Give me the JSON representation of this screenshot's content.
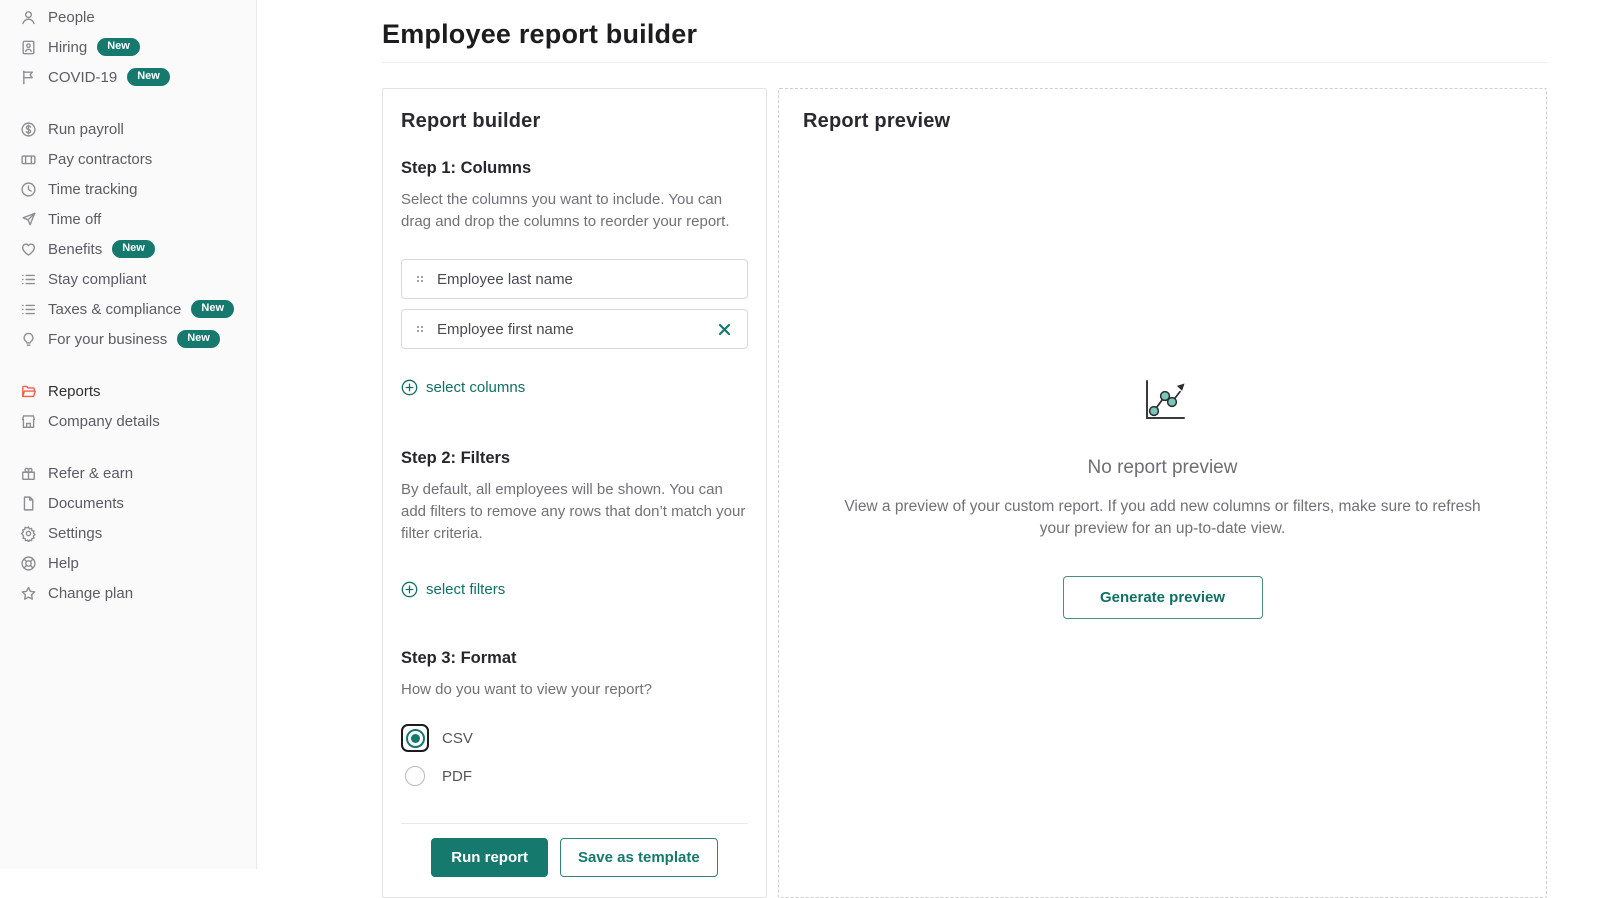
{
  "colors": {
    "teal": "#15796d",
    "coral": "#f45d48",
    "badge_bg": "#15796d"
  },
  "page": {
    "title": "Employee report builder"
  },
  "sidebar": {
    "groups": [
      {
        "items": [
          {
            "label": "People",
            "icon": "people-icon",
            "badge": null
          },
          {
            "label": "Hiring",
            "icon": "id-badge-icon",
            "badge": "New"
          },
          {
            "label": "COVID-19",
            "icon": "flag-icon",
            "badge": "New"
          }
        ]
      },
      {
        "items": [
          {
            "label": "Run payroll",
            "icon": "dollar-circle-icon",
            "badge": null
          },
          {
            "label": "Pay contractors",
            "icon": "wallet-icon",
            "badge": null
          },
          {
            "label": "Time tracking",
            "icon": "clock-icon",
            "badge": null
          },
          {
            "label": "Time off",
            "icon": "airplane-icon",
            "badge": null
          },
          {
            "label": "Benefits",
            "icon": "heart-icon",
            "badge": "New"
          },
          {
            "label": "Stay compliant",
            "icon": "list-icon",
            "badge": null
          },
          {
            "label": "Taxes & compliance",
            "icon": "list-icon",
            "badge": "New"
          },
          {
            "label": "For your business",
            "icon": "lightbulb-icon",
            "badge": "New"
          }
        ]
      },
      {
        "items": [
          {
            "label": "Reports",
            "icon": "folder-icon",
            "badge": null,
            "active": true
          },
          {
            "label": "Company details",
            "icon": "storefront-icon",
            "badge": null
          }
        ]
      },
      {
        "items": [
          {
            "label": "Refer & earn",
            "icon": "gift-icon",
            "badge": null
          },
          {
            "label": "Documents",
            "icon": "document-icon",
            "badge": null
          },
          {
            "label": "Settings",
            "icon": "gear-icon",
            "badge": null
          },
          {
            "label": "Help",
            "icon": "help-icon",
            "badge": null
          },
          {
            "label": "Change plan",
            "icon": "star-icon",
            "badge": null
          }
        ]
      }
    ]
  },
  "builder": {
    "title": "Report builder",
    "step1": {
      "heading": "Step 1: Columns",
      "description": "Select the columns you want to include. You can drag and drop the columns to reorder your report.",
      "columns": [
        {
          "label": "Employee last name",
          "removable": false
        },
        {
          "label": "Employee first name",
          "removable": true
        }
      ],
      "select_link": "select columns"
    },
    "step2": {
      "heading": "Step 2: Filters",
      "description": "By default, all employees will be shown. You can add filters to remove any rows that don’t match your filter criteria.",
      "select_link": "select filters"
    },
    "step3": {
      "heading": "Step 3: Format",
      "question": "How do you want to view your report?",
      "options": [
        {
          "label": "CSV",
          "selected": true
        },
        {
          "label": "PDF",
          "selected": false
        }
      ]
    },
    "run_button": "Run report",
    "save_button": "Save as template"
  },
  "preview": {
    "title": "Report preview",
    "empty_title": "No report preview",
    "empty_description": "View a preview of your custom report. If you add new columns or filters, make sure to refresh your preview for an up-to-date view.",
    "generate_button": "Generate preview"
  }
}
